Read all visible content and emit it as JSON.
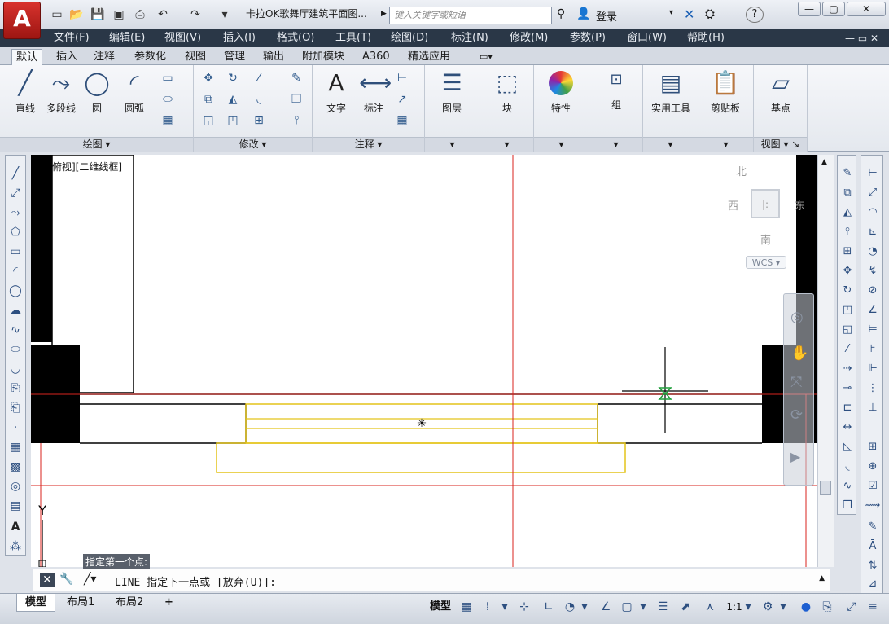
{
  "titlebar": {
    "logo": "A",
    "doc_title": "卡拉OK歌舞厅建筑平面图...",
    "search_placeholder": "键入关键字或短语",
    "login": "登录",
    "help": "?",
    "icons": [
      "new-icon",
      "open-icon",
      "save-icon",
      "saveas-icon",
      "print-icon",
      "undo-icon",
      "redo-icon",
      "dropdown-icon"
    ]
  },
  "menubar": [
    "文件(F)",
    "编辑(E)",
    "视图(V)",
    "插入(I)",
    "格式(O)",
    "工具(T)",
    "绘图(D)",
    "标注(N)",
    "修改(M)",
    "参数(P)",
    "窗口(W)",
    "帮助(H)"
  ],
  "ribbon_tabs": [
    "默认",
    "插入",
    "注释",
    "参数化",
    "视图",
    "管理",
    "输出",
    "附加模块",
    "A360",
    "精选应用"
  ],
  "ribbon": {
    "draw": {
      "title": "绘图",
      "tools": [
        "直线",
        "多段线",
        "圆",
        "圆弧"
      ]
    },
    "modify": {
      "title": "修改"
    },
    "annotation": {
      "title": "注释",
      "tools": [
        "文字",
        "标注"
      ]
    },
    "layers": {
      "label": "图层"
    },
    "block": {
      "label": "块"
    },
    "properties": {
      "label": "特性"
    },
    "groups": {
      "label": "组"
    },
    "utilities": {
      "label": "实用工具"
    },
    "clipboard": {
      "label": "剪贴板"
    },
    "view": {
      "label": "基点",
      "title": "视图"
    }
  },
  "viewport": {
    "label": "俯视][二维线框]",
    "viewcube": {
      "north": "北",
      "south": "南",
      "east": "东",
      "west": "西",
      "wcs": "WCS"
    },
    "y_axis": "Y"
  },
  "command": {
    "prompt_tip": "指定第一个点:",
    "text": "LINE 指定下一点或 [放弃(U)]:"
  },
  "layout_tabs": [
    "模型",
    "布局1",
    "布局2",
    "+"
  ],
  "status": {
    "model": "模型",
    "scale": "1:1"
  },
  "colors": {
    "accent": "#c4211d",
    "menubar": "#2a3747",
    "red_line": "#d8231e",
    "yellow_line": "#e4c41a"
  }
}
